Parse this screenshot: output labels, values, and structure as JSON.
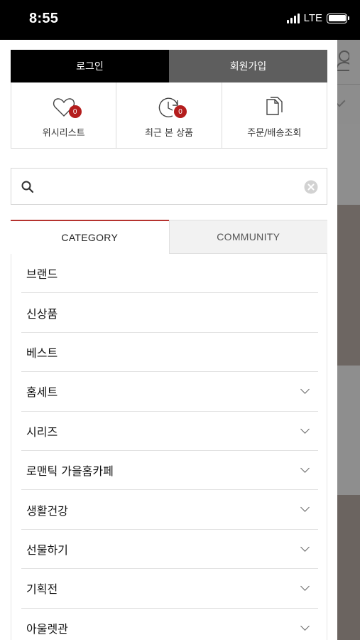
{
  "status_bar": {
    "time": "8:55",
    "network": "LTE"
  },
  "drawer": {
    "login_label": "로그인",
    "join_label": "회원가입",
    "quick_links": [
      {
        "label": "위시리스트",
        "icon": "heart-icon",
        "badge": "0"
      },
      {
        "label": "최근 본 상품",
        "icon": "clock-icon",
        "badge": "0"
      },
      {
        "label": "주문/배송조회",
        "icon": "documents-icon"
      }
    ],
    "search": {
      "value": "",
      "placeholder": ""
    },
    "tabs": {
      "category": "CATEGORY",
      "community": "COMMUNITY"
    },
    "categories": [
      {
        "label": "브랜드",
        "expandable": false
      },
      {
        "label": "신상품",
        "expandable": false
      },
      {
        "label": "베스트",
        "expandable": false
      },
      {
        "label": "홈세트",
        "expandable": true
      },
      {
        "label": "시리즈",
        "expandable": true
      },
      {
        "label": "로맨틱 가을홈카페",
        "expandable": true
      },
      {
        "label": "생활건강",
        "expandable": true
      },
      {
        "label": "선물하기",
        "expandable": true
      },
      {
        "label": "기획전",
        "expandable": true
      },
      {
        "label": "아울렛관",
        "expandable": true
      }
    ]
  },
  "colors": {
    "accent": "#b5322e",
    "badge": "#b41d1d",
    "login_bg": "#000000",
    "join_bg": "#5e5e5e"
  }
}
